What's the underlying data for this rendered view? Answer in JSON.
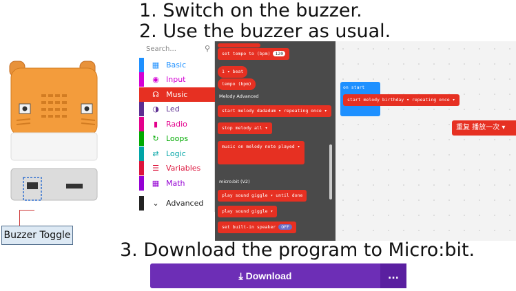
{
  "steps": {
    "step1": "1. Switch on the buzzer.",
    "step2": "2. Use the buzzer as usual.",
    "step3": "3. Download the program to Micro:bit."
  },
  "device": {
    "buzzer_label": "Buzzer Toggle"
  },
  "toolbox": {
    "search_placeholder": "Search...",
    "categories": [
      {
        "label": "Basic",
        "color": "#1e90ff",
        "icon": "grid-icon"
      },
      {
        "label": "Input",
        "color": "#d400d4",
        "icon": "target-icon"
      },
      {
        "label": "Music",
        "color": "#e63022",
        "icon": "headphones-icon"
      },
      {
        "label": "Led",
        "color": "#5c2d91",
        "icon": "toggle-icon"
      },
      {
        "label": "Radio",
        "color": "#e3008c",
        "icon": "signal-icon"
      },
      {
        "label": "Loops",
        "color": "#00aa00",
        "icon": "refresh-icon"
      },
      {
        "label": "Logic",
        "color": "#00a4a6",
        "icon": "shuffle-icon"
      },
      {
        "label": "Variables",
        "color": "#dc143c",
        "icon": "lines-icon"
      },
      {
        "label": "Math",
        "color": "#9400d3",
        "icon": "calculator-icon"
      },
      {
        "label": "Advanced",
        "color": "#222222",
        "icon": "chevron-down-icon"
      }
    ]
  },
  "flyout": {
    "blocks": {
      "set_tempo": "set tempo to (bpm)",
      "tempo_value": "120",
      "beat": "1 ▾ beat",
      "tempo_bpm": "tempo (bpm)",
      "section_advanced": "Melody Advanced",
      "start_melody": "start melody  dadadum ▾  repeating  once ▾",
      "stop_melody": "stop melody  all ▾",
      "music_on": "music on  melody note played ▾",
      "section_v2": "micro:bit (V2)",
      "play_sound_until": "play sound  giggle ▾  until done",
      "play_sound": "play sound  giggle ▾",
      "speaker": "set built-in speaker",
      "speaker_value": "OFF"
    }
  },
  "workspace": {
    "on_start": "on start",
    "start_melody": "start melody   birthday ▾   repeating  once ▾",
    "repeat": "重复  播放一次 ▾"
  },
  "download": {
    "label": "Download",
    "more": "..."
  },
  "colors": {
    "music": "#e63022",
    "download": "#6d2eb6",
    "flyout_bg": "#4a4a4a",
    "on_start": "#1e90ff"
  }
}
